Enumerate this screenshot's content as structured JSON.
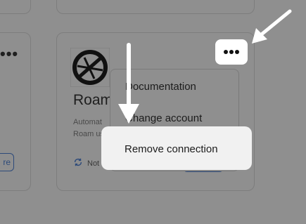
{
  "left_card": {
    "button_label": "re"
  },
  "main_card": {
    "title": "Roam",
    "description_line1": "Automat",
    "description_line2": "Roam us",
    "sync_status": "Not s"
  },
  "menu": {
    "items": [
      {
        "label": "Documentation"
      },
      {
        "label": "Change account"
      },
      {
        "label": "Remove connection"
      }
    ]
  },
  "icons": {
    "more": "more-horizontal-icon",
    "sync": "sync-icon",
    "logo": "roam-logo-icon",
    "arrow_down": "arrow-down-icon",
    "arrow_diag": "arrow-diagonal-icon"
  },
  "colors": {
    "overlay": "#8f8f8f",
    "highlight": "#f1f1f1",
    "button_bg": "#ffffff",
    "accent": "#2d4a7a"
  }
}
